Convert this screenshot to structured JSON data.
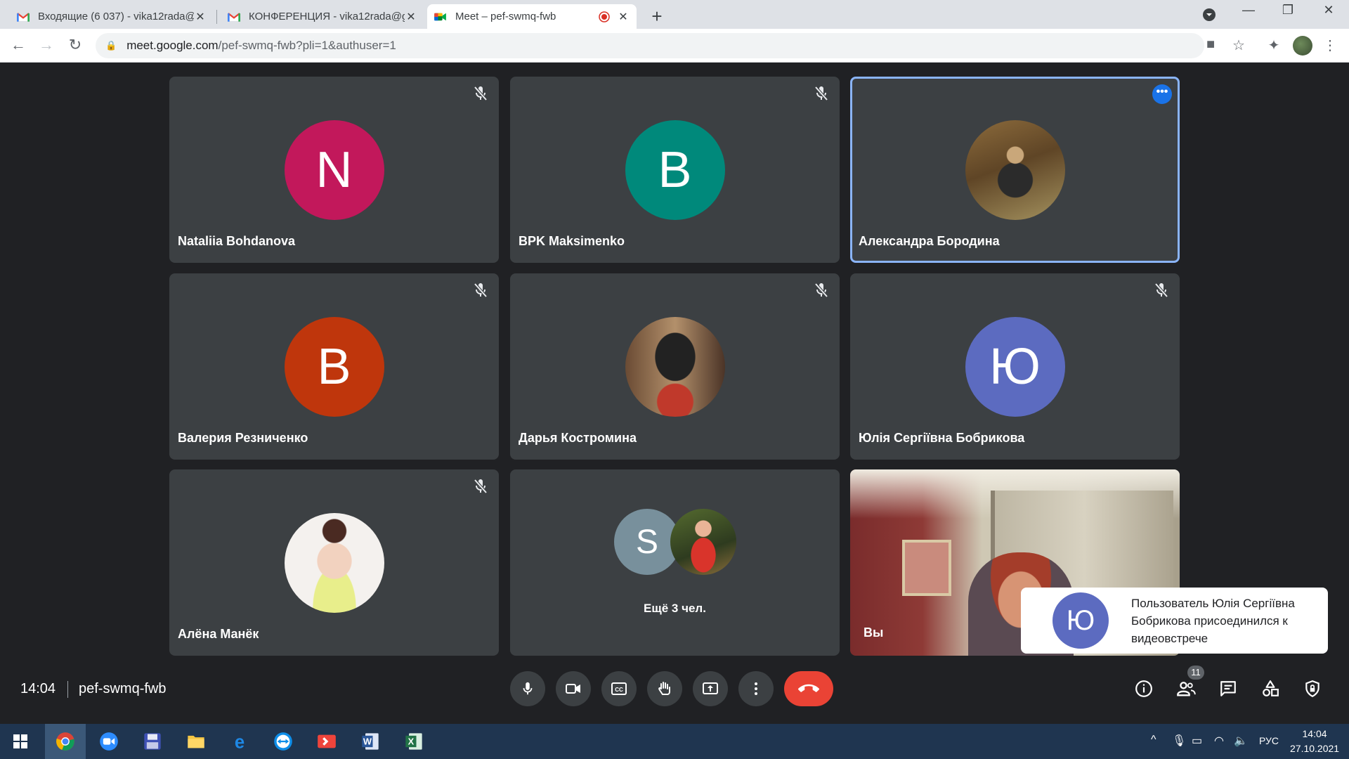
{
  "browser": {
    "tabs": [
      {
        "title": "Входящие (6 037) - vika12rada@",
        "favicon": "gmail-icon"
      },
      {
        "title": "КОНФЕРЕНЦИЯ - vika12rada@g",
        "favicon": "gmail-icon"
      },
      {
        "title": "Meet – pef-swmq-fwb",
        "favicon": "meet-icon",
        "recording": true
      }
    ],
    "url_host": "meet.google.com",
    "url_path": "/pef-swmq-fwb?pli=1&authuser=1"
  },
  "participants": [
    {
      "name": "Nataliia Bohdanova",
      "initial": "N",
      "color": "#c2185b",
      "muted": true
    },
    {
      "name": "BPK Maksimenko",
      "initial": "B",
      "color": "#00897b",
      "muted": true
    },
    {
      "name": "Александра Бородина",
      "photo": true,
      "speaking": true
    },
    {
      "name": "Валерия Резниченко",
      "initial": "В",
      "color": "#bf360c",
      "muted": true
    },
    {
      "name": "Дарья Костромина",
      "photo": true,
      "muted": true
    },
    {
      "name": "Юлія Сергіївна Бобрикова",
      "initial": "Ю",
      "color": "#5c6bc0",
      "muted": true
    },
    {
      "name": "Алёна Манёк",
      "photo": true,
      "muted": true
    }
  ],
  "more": {
    "initial": "S",
    "color": "#78909c",
    "label": "Ещё 3 чел."
  },
  "self": {
    "label": "Вы"
  },
  "toast": {
    "initial": "Ю",
    "text": "Пользователь Юлія Сергіївна Бобрикова присоединился к видеовстрече"
  },
  "meeting": {
    "time": "14:04",
    "code": "pef-swmq-fwb",
    "participant_count": "11"
  },
  "taskbar": {
    "lang": "РУС",
    "time": "14:04",
    "date": "27.10.2021"
  }
}
